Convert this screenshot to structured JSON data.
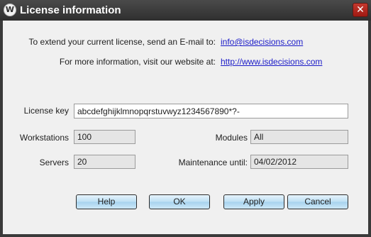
{
  "window": {
    "title": "License information",
    "icon": "app-logo-icon",
    "icon_glyph": "W",
    "close_glyph": "✕"
  },
  "info": {
    "email_label": "To extend your current license, send an E-mail to:",
    "email_link": "info@isdecisions.com",
    "website_label": "For more information, visit our website at:",
    "website_link": "http://www.isdecisions.com"
  },
  "fields": {
    "license_key_label": "License key",
    "license_key_value": "abcdefghijklmnopqrstuvwyz1234567890*?-",
    "workstations_label": "Workstations",
    "workstations_value": "100",
    "servers_label": "Servers",
    "servers_value": "20",
    "modules_label": "Modules",
    "modules_value": "All",
    "maintenance_label": "Maintenance until:",
    "maintenance_value": "04/02/2012"
  },
  "buttons": {
    "help": "Help",
    "ok": "OK",
    "apply": "Apply",
    "cancel": "Cancel"
  },
  "colors": {
    "titlebar": "#3a3a3a",
    "link": "#1a1ac8",
    "close": "#b3241c"
  }
}
